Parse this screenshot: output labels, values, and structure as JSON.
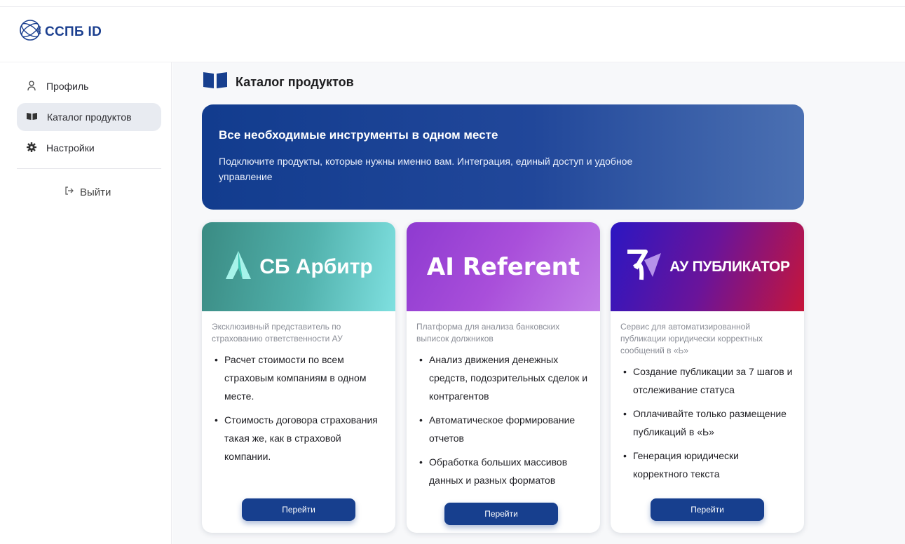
{
  "brand": {
    "name": "ССПБ ID"
  },
  "sidebar": {
    "items": [
      {
        "label": "Профиль",
        "icon": "user-icon"
      },
      {
        "label": "Каталог продуктов",
        "icon": "book-icon",
        "active": true
      },
      {
        "label": "Настройки",
        "icon": "gear-icon"
      }
    ],
    "logout_label": "Выйти"
  },
  "page": {
    "title": "Каталог продуктов"
  },
  "hero": {
    "title": "Все необходимые инструменты в одном месте",
    "text": "Подключите продукты, которые нужны именно вам. Интеграция, единый доступ и удобное управление"
  },
  "cards": [
    {
      "logo_text": "СБ Арбитр",
      "description": "Эксклюзивный представитель по страхованию ответственности АУ",
      "bullets": [
        "Расчет стоимости по всем страховым компаниям в одном месте.",
        "Стоимость договора страхования такая же, как в страховой компании."
      ],
      "button": "Перейти"
    },
    {
      "logo_text": "AI Referent",
      "description": "Платформа для анализа банковских выписок должников",
      "bullets": [
        "Анализ движения денежных средств, подозрительных сделок и контрагентов",
        "Автоматическое формирование отчетов",
        "Обработка больших массивов данных и разных форматов"
      ],
      "button": "Перейти"
    },
    {
      "logo_text": "АУ ПУБЛИКАТОР",
      "description": "Сервис для автоматизированной публикации юридически корректных сообщений в «Ь»",
      "bullets": [
        "Создание публикации за 7 шагов и отслеживание статуса",
        "Оплачивайте только размещение публикаций в «Ь»",
        "Генерация юридически корректного текста"
      ],
      "button": "Перейти"
    }
  ],
  "colors": {
    "accent": "#173f8e",
    "brand": "#1b3f8f"
  }
}
